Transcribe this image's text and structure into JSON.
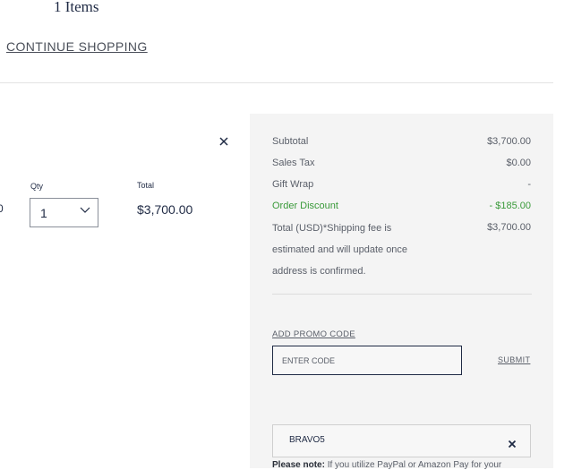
{
  "header": {
    "items_count": "1 Items",
    "continue_label": "CONTINUE SHOPPING"
  },
  "cart_item": {
    "edge_fragment": "0",
    "qty_label": "Qty",
    "qty_value": "1",
    "total_label": "Total",
    "total_value": "$3,700.00",
    "remove_icon": "close-icon"
  },
  "summary": {
    "rows": [
      {
        "label": "Subtotal",
        "value": "$3,700.00"
      },
      {
        "label": "Sales Tax",
        "value": "$0.00"
      },
      {
        "label": "Gift Wrap",
        "value": "-"
      },
      {
        "label": "Order Discount",
        "value": "- $185.00"
      }
    ],
    "total_text": "Total (USD)*Shipping fee is estimated and will update once address is confirmed.",
    "total_value": "$3,700.00",
    "promo_label": "ADD PROMO CODE",
    "promo_placeholder": "ENTER CODE",
    "submit_label": "SUBMIT",
    "applied_code": "BRAVO5",
    "note_bold": "Please note:",
    "note_text": " If you utilize PayPal or Amazon Pay for your"
  },
  "colors": {
    "text_primary": "#1f2a44",
    "text_muted": "#5a5f69",
    "discount_green": "#3a9a3a",
    "panel_bg": "#f4f4f4"
  }
}
